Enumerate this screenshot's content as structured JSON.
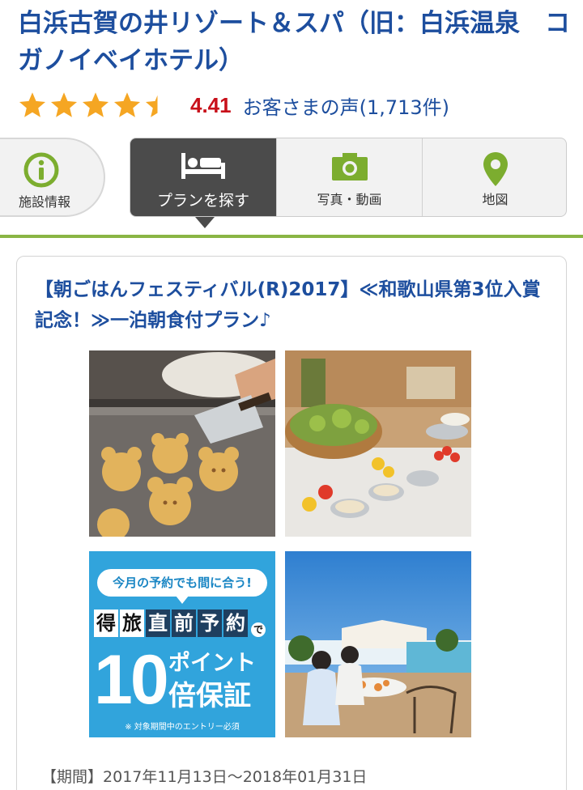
{
  "hotel": {
    "name": "白浜古賀の井リゾート＆スパ（旧：白浜温泉　コガノイベイホテル）"
  },
  "rating": {
    "stars": 4.41,
    "score": "4.41",
    "review_link": "お客さまの声(1,713件)",
    "star_color": "#f5a623"
  },
  "tabs": {
    "facility": {
      "label": "施設情報",
      "icon": "info-icon"
    },
    "plan": {
      "label": "プランを探す",
      "icon": "bed-icon",
      "active": true
    },
    "photo": {
      "label": "写真・動画",
      "icon": "camera-icon"
    },
    "map": {
      "label": "地図",
      "icon": "map-pin-icon"
    }
  },
  "colors": {
    "brand_blue": "#1d4e9e",
    "accent_green": "#8ab544",
    "score_red": "#c8101a",
    "active_tab": "#4b4b4b"
  },
  "plan": {
    "title": "【朝ごはんフェスティバル(R)2017】≪和歌山県第3位入賞記念！≫一泊朝食付プラン♪",
    "photos": [
      {
        "icon": "pancake-photo"
      },
      {
        "icon": "buffet-photo"
      },
      {
        "icon": "promo-banner"
      },
      {
        "icon": "terrace-photo"
      }
    ],
    "banner": {
      "top": "今月の予約でも間に合う!",
      "chars": [
        "得",
        "旅",
        "直",
        "前",
        "予",
        "約"
      ],
      "de": "で",
      "big": "10",
      "points": "ポイント",
      "guarantee": "倍保証",
      "note": "※ 対象期間中のエントリー必須"
    },
    "period_label": "【期間】",
    "period": "2017年11月13日～2018年01月31日"
  }
}
